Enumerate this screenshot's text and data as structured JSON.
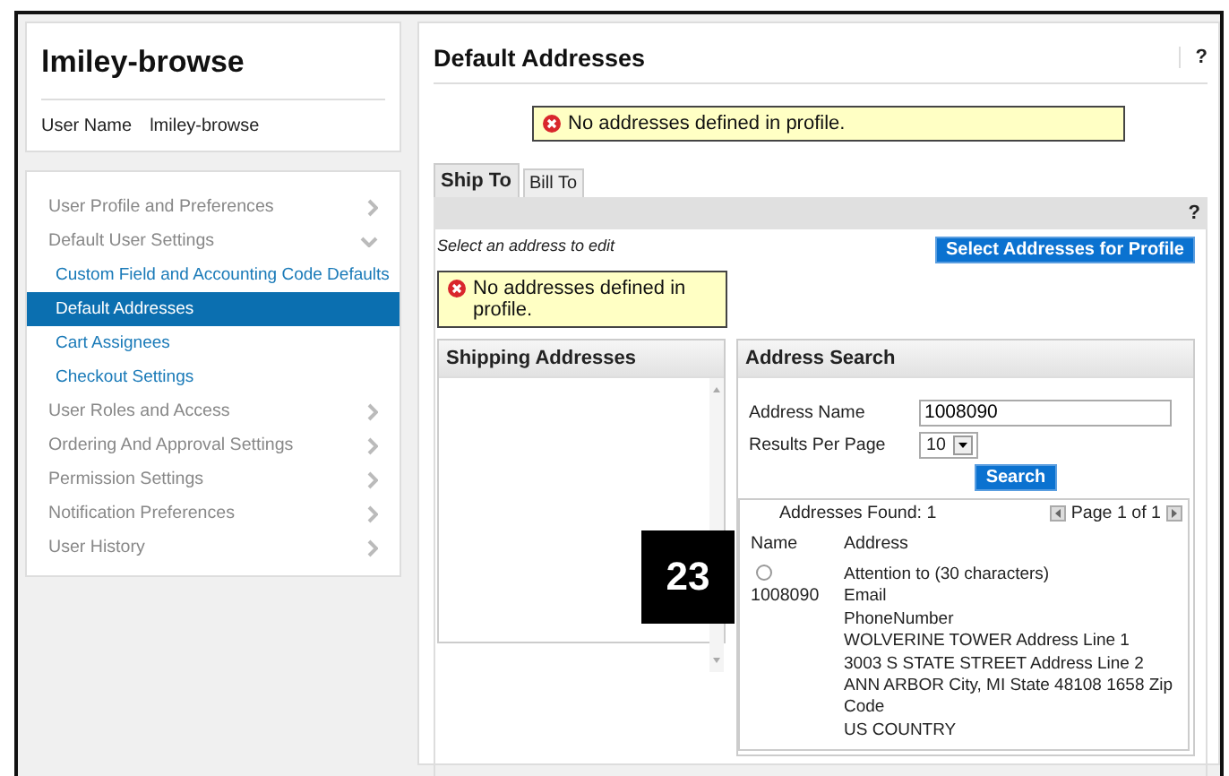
{
  "profile": {
    "title": "lmiley-browse",
    "user_label": "User Name",
    "user_value": "lmiley-browse"
  },
  "nav": [
    {
      "label": "User Profile and Preferences",
      "expanded": false
    },
    {
      "label": "Default User Settings",
      "expanded": true,
      "children": [
        {
          "label": "Custom Field and Accounting Code Defaults",
          "selected": false
        },
        {
          "label": "Default Addresses",
          "selected": true
        },
        {
          "label": "Cart Assignees",
          "selected": false
        },
        {
          "label": "Checkout Settings",
          "selected": false
        }
      ]
    },
    {
      "label": "User Roles and Access",
      "expanded": false
    },
    {
      "label": "Ordering And Approval Settings",
      "expanded": false
    },
    {
      "label": "Permission Settings",
      "expanded": false
    },
    {
      "label": "Notification Preferences",
      "expanded": false
    },
    {
      "label": "User History",
      "expanded": false
    }
  ],
  "main": {
    "title": "Default Addresses",
    "help": "?",
    "alert": "No addresses defined in profile.",
    "tabs": [
      {
        "label": "Ship To",
        "selected": true
      },
      {
        "label": "Bill To",
        "selected": false
      }
    ],
    "tab_help": "?",
    "hint": "Select an address to edit",
    "select_button": "Select Addresses for Profile",
    "inner_alert": "No addresses defined in profile.",
    "shipping": {
      "title": "Shipping Addresses"
    },
    "search": {
      "title": "Address Search",
      "fields": [
        {
          "kind": "text",
          "label": "Address Name",
          "value": "1008090"
        },
        {
          "kind": "select",
          "label": "Results Per Page",
          "value": "10"
        }
      ],
      "button": "Search",
      "found": "Addresses Found: 1",
      "page": "Page 1 of 1",
      "columns": [
        "Name",
        "Address"
      ],
      "rows": [
        {
          "selected": false,
          "name": "1008090",
          "address": [
            "Attention to (30 characters)",
            "Email",
            "PhoneNumber",
            "WOLVERINE TOWER Address Line 1",
            "3003 S STATE STREET Address Line 2",
            "ANN ARBOR City, MI State 48108 1658 Zip Code",
            "US COUNTRY"
          ]
        }
      ]
    }
  },
  "callout": "23"
}
